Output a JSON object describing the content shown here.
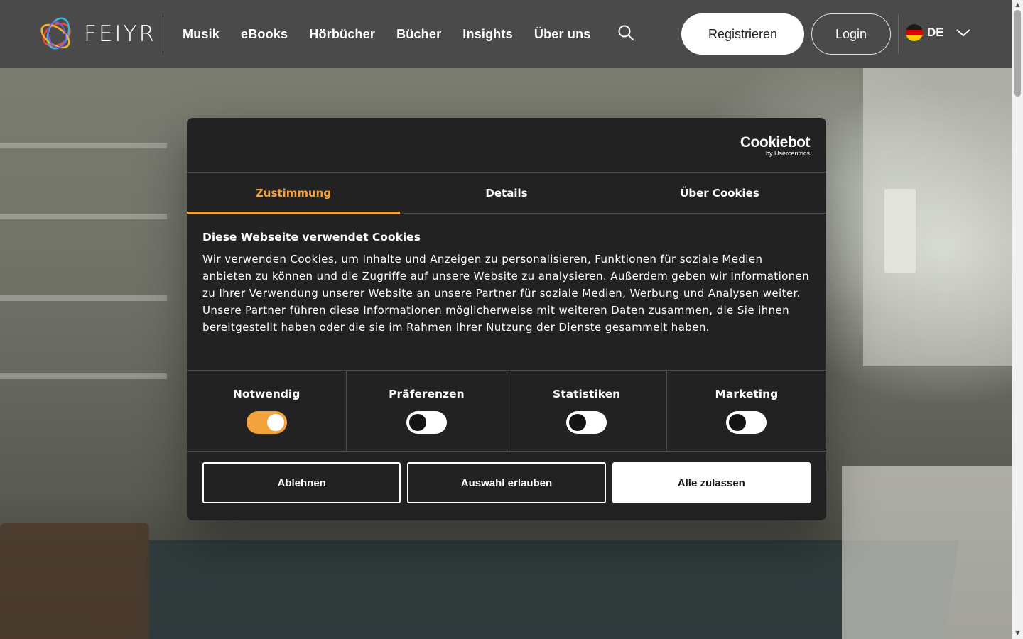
{
  "header": {
    "logo_text": "FEIYR",
    "nav": [
      {
        "label": "Musik"
      },
      {
        "label": "eBooks"
      },
      {
        "label": "Hörbücher"
      },
      {
        "label": "Bücher"
      },
      {
        "label": "Insights"
      },
      {
        "label": "Über uns"
      }
    ],
    "search_icon": "search-icon",
    "register_label": "Registrieren",
    "login_label": "Login",
    "language": {
      "code": "DE",
      "flag": "germany-flag-icon"
    }
  },
  "cookie_dialog": {
    "brand": {
      "name": "Cookiebot",
      "sub": "by Usercentrics"
    },
    "tabs": [
      {
        "label": "Zustimmung",
        "active": true
      },
      {
        "label": "Details",
        "active": false
      },
      {
        "label": "Über Cookies",
        "active": false
      }
    ],
    "title": "Diese Webseite verwendet Cookies",
    "text": "Wir verwenden Cookies, um Inhalte und Anzeigen zu personalisieren, Funktionen für soziale Medien anbieten zu können und die Zugriffe auf unsere Website zu analysieren. Außerdem geben wir Informationen zu Ihrer Verwendung unserer Website an unsere Partner für soziale Medien, Werbung und Analysen weiter. Unsere Partner führen diese Informationen möglicherweise mit weiteren Daten zusammen, die Sie ihnen bereitgestellt haben oder die sie im Rahmen Ihrer Nutzung der Dienste gesammelt haben.",
    "toggles": [
      {
        "label": "Notwendig",
        "on": true
      },
      {
        "label": "Präferenzen",
        "on": false
      },
      {
        "label": "Statistiken",
        "on": false
      },
      {
        "label": "Marketing",
        "on": false
      }
    ],
    "buttons": {
      "reject": "Ablehnen",
      "allow_selection": "Auswahl erlauben",
      "allow_all": "Alle zulassen"
    }
  },
  "colors": {
    "accent": "#f4a23c",
    "header_bg": "#4a4a4a",
    "dialog_bg": "#232222"
  }
}
